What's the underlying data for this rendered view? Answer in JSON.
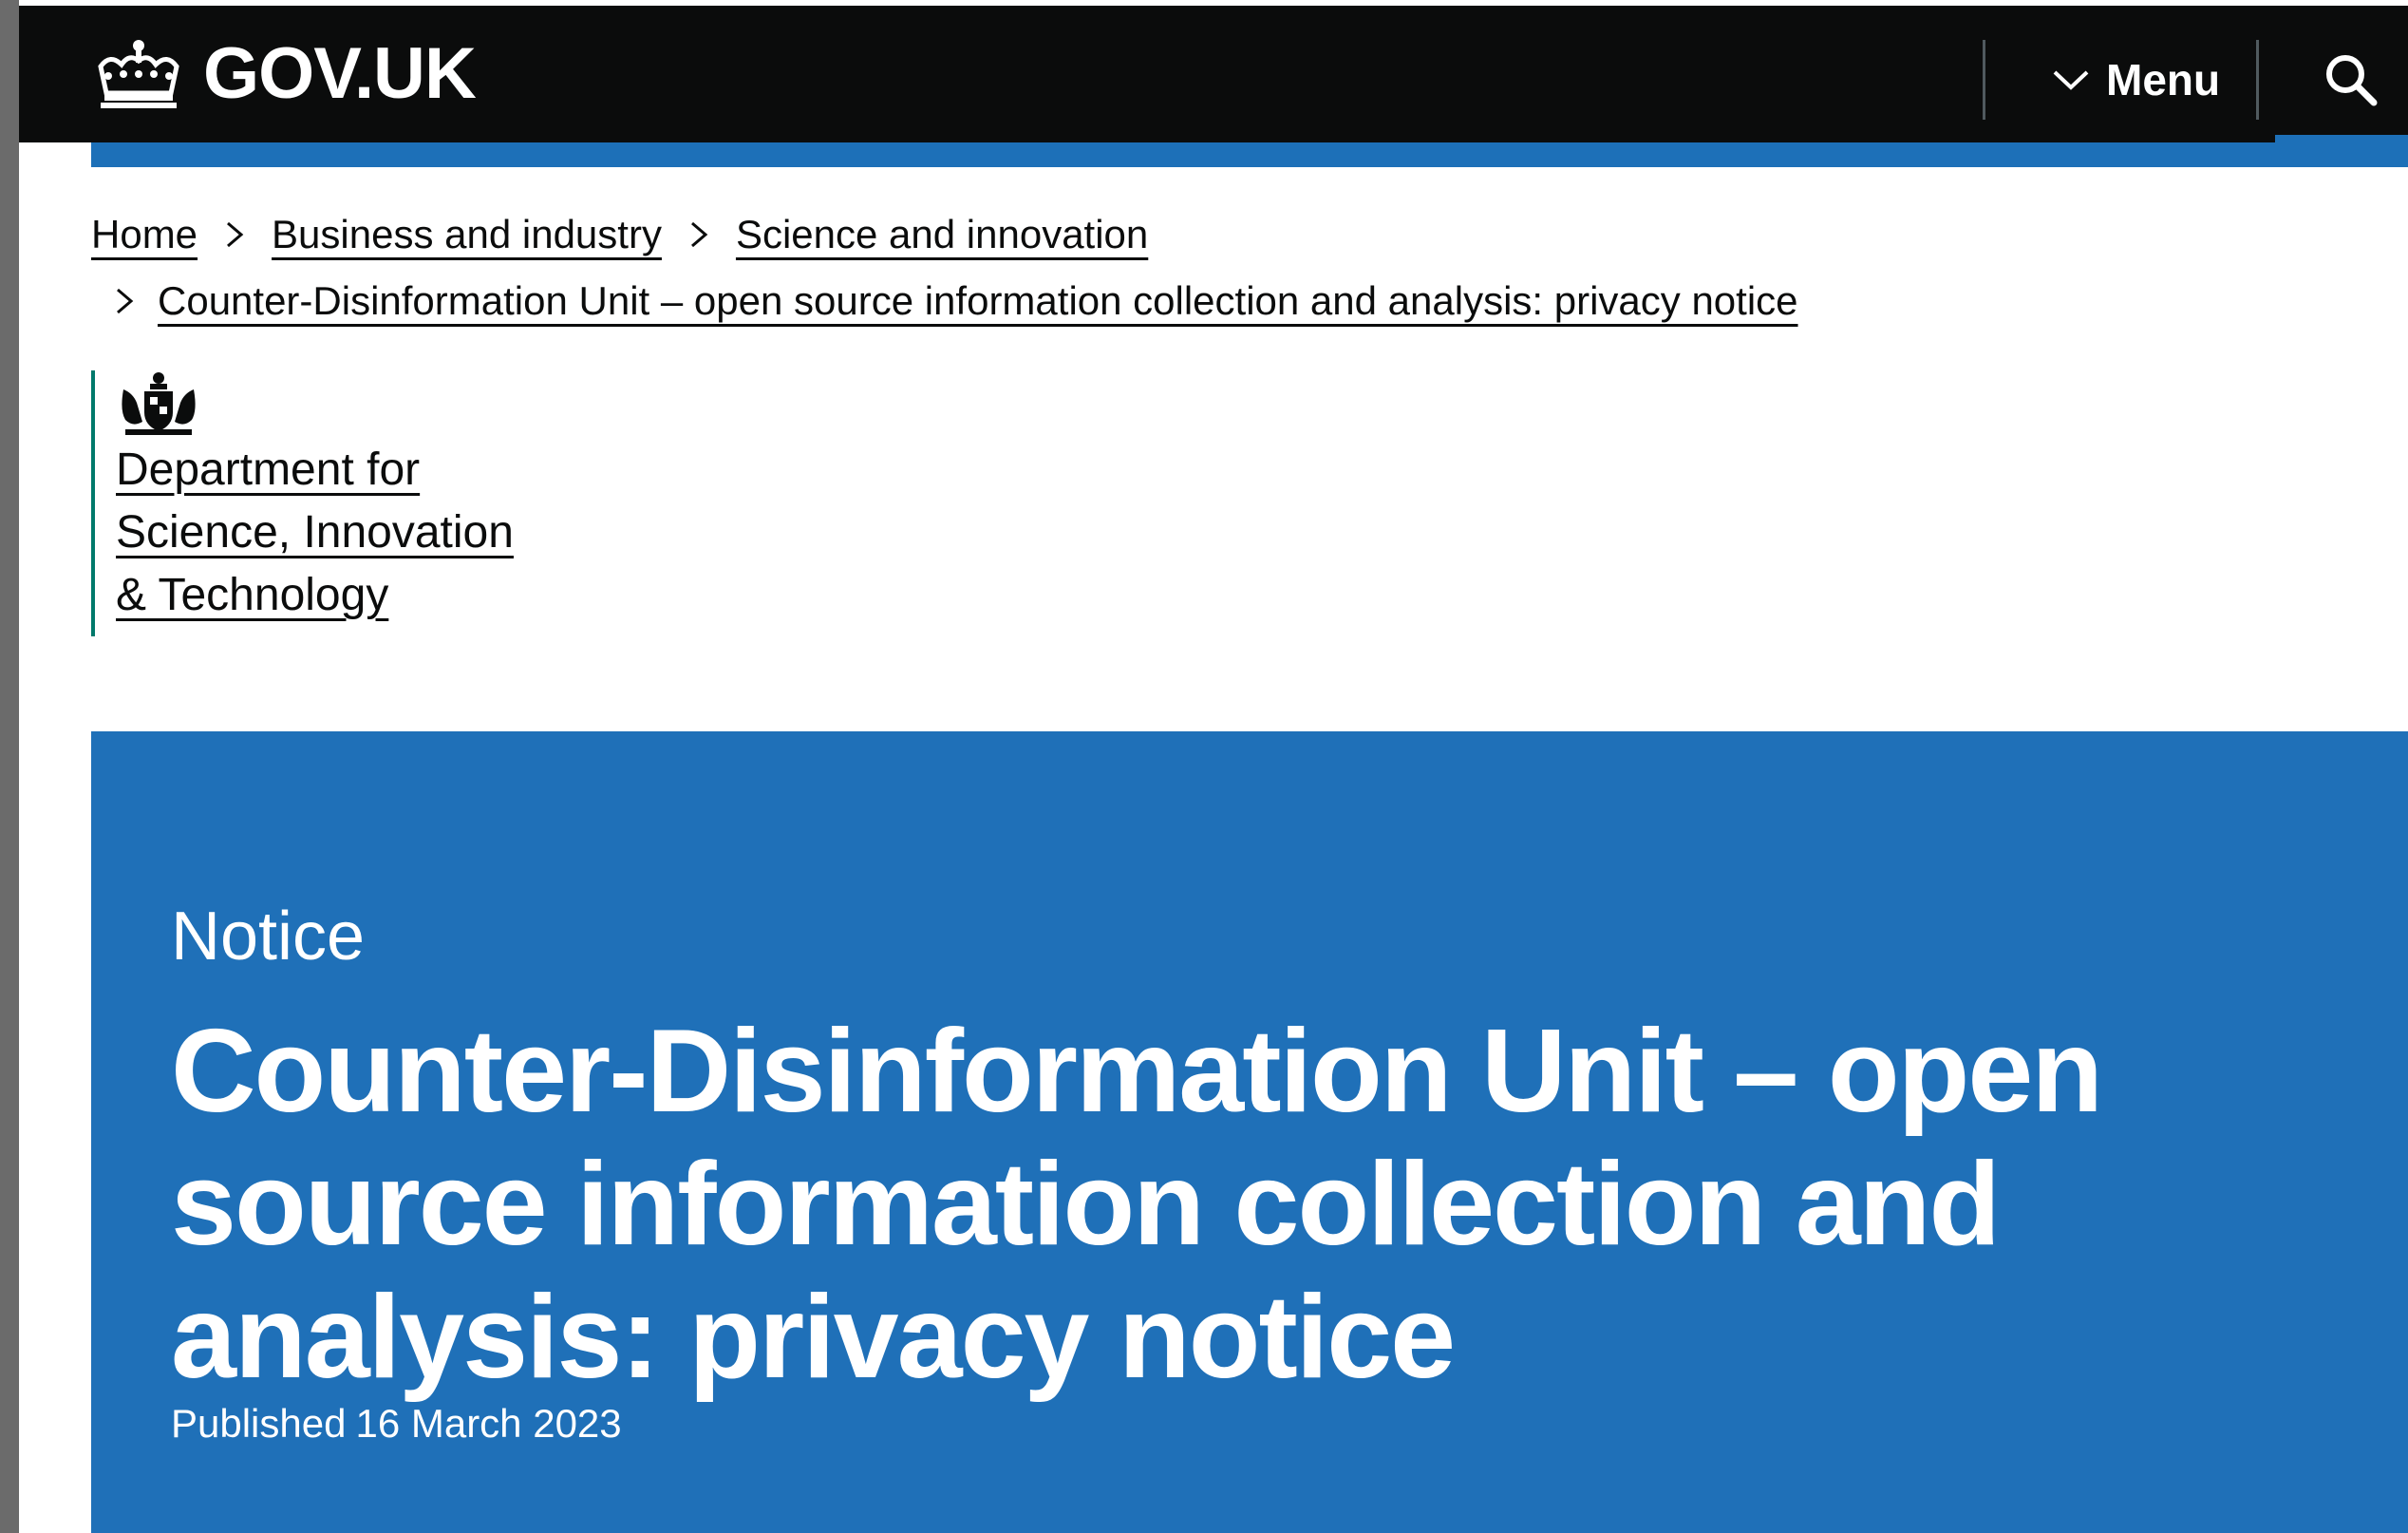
{
  "header": {
    "logo_text": "GOV.UK",
    "menu_label": "Menu",
    "search_icon": "search-icon",
    "colors": {
      "background": "#0b0c0c",
      "accent": "#1d70b8"
    }
  },
  "breadcrumb": {
    "items": [
      {
        "label": "Home"
      },
      {
        "label": "Business and industry"
      },
      {
        "label": "Science and innovation"
      },
      {
        "label": "Counter-Disinformation Unit – open source information collection and analysis: privacy notice"
      }
    ]
  },
  "organisation": {
    "crest_icon": "royal-coat-of-arms-icon",
    "name_lines": [
      "Department for",
      "Science, Innovation",
      "& Technology"
    ],
    "border_color": "#00796b"
  },
  "hero": {
    "document_type": "Notice",
    "title": "Counter-Disinformation Unit – open source information collection and analysis: privacy notice",
    "published_label": "Published",
    "published_date": "16 March 2023",
    "background_color": "#1f70b8"
  }
}
